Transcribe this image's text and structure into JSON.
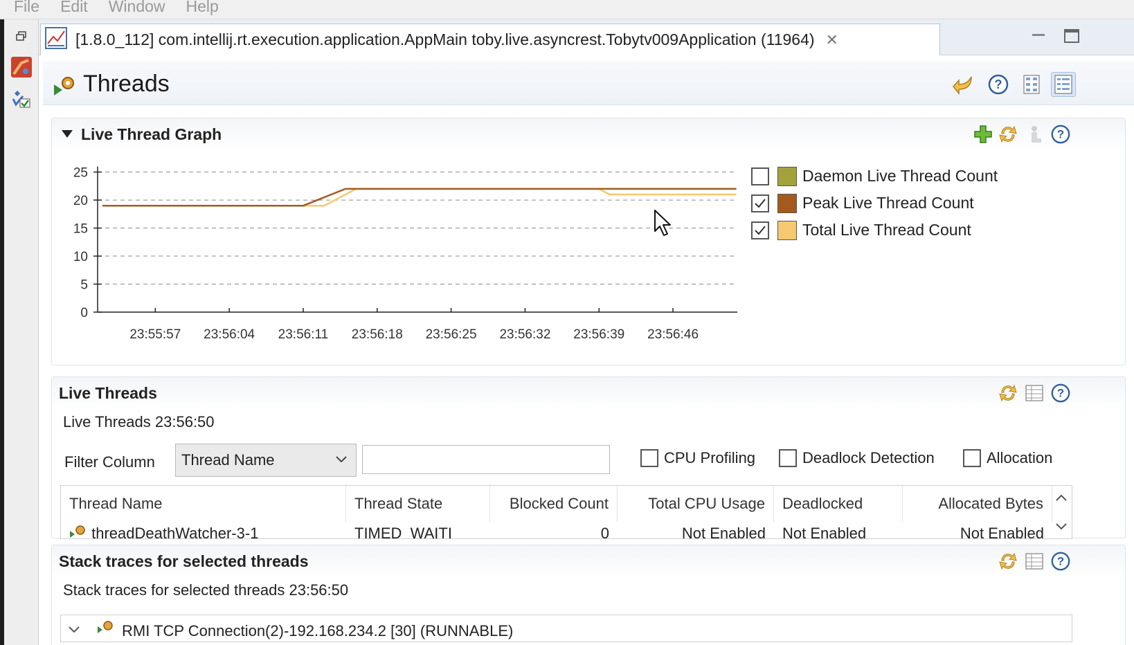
{
  "menubar": {
    "items": [
      "File",
      "Edit",
      "Window",
      "Help"
    ]
  },
  "tab": {
    "title": "[1.8.0_112] com.intellij.rt.execution.application.AppMain toby.live.asyncrest.Tobytv009Application (11964)"
  },
  "page": {
    "title": "Threads"
  },
  "graph_section": {
    "title": "Live Thread Graph",
    "legend": [
      {
        "label": "Daemon Live Thread Count",
        "checked": false,
        "color": "#a3a23a"
      },
      {
        "label": "Peak Live Thread Count",
        "checked": true,
        "color": "#a45a1e"
      },
      {
        "label": "Total Live Thread Count",
        "checked": true,
        "color": "#f6c870"
      }
    ]
  },
  "chart_data": {
    "type": "line",
    "title": "",
    "xlabel": "",
    "ylabel": "",
    "ylim": [
      0,
      25
    ],
    "yticks": [
      0,
      5,
      10,
      15,
      20,
      25
    ],
    "xticks": [
      "23:55:57",
      "23:56:04",
      "23:56:11",
      "23:56:18",
      "23:56:25",
      "23:56:32",
      "23:56:39",
      "23:56:46"
    ],
    "grid": true,
    "series": [
      {
        "name": "Peak Live Thread Count",
        "color": "#a45a1e",
        "points": [
          [
            "23:55:52",
            19
          ],
          [
            "23:56:11",
            19
          ],
          [
            "23:56:15",
            22
          ],
          [
            "23:56:52",
            22
          ]
        ]
      },
      {
        "name": "Total Live Thread Count",
        "color": "#f6c870",
        "points": [
          [
            "23:55:52",
            19
          ],
          [
            "23:56:13",
            19
          ],
          [
            "23:56:16",
            22
          ],
          [
            "23:56:39",
            22
          ],
          [
            "23:56:40",
            21
          ],
          [
            "23:56:52",
            21
          ]
        ]
      }
    ]
  },
  "live_threads": {
    "title": "Live Threads",
    "subtitle": "Live Threads 23:56:50",
    "filter_label": "Filter Column",
    "filter_selected": "Thread Name",
    "filter_value": "",
    "options": [
      {
        "label": "CPU Profiling",
        "checked": false
      },
      {
        "label": "Deadlock Detection",
        "checked": false
      },
      {
        "label": "Allocation",
        "checked": false
      }
    ],
    "columns": [
      "Thread Name",
      "Thread State",
      "Blocked Count",
      "Total CPU Usage",
      "Deadlocked",
      "Allocated Bytes"
    ],
    "rows": [
      {
        "name": "threadDeathWatcher-3-1",
        "state": "TIMED_WAITI",
        "blocked": "0",
        "cpu": "Not Enabled",
        "deadlocked": "Not Enabled",
        "allocated": "Not Enabled"
      }
    ]
  },
  "stack_traces": {
    "title": "Stack traces for selected threads",
    "subtitle": "Stack traces for selected threads 23:56:50",
    "first_row": "RMI TCP Connection(2)-192.168.234.2 [30] (RUNNABLE)"
  }
}
